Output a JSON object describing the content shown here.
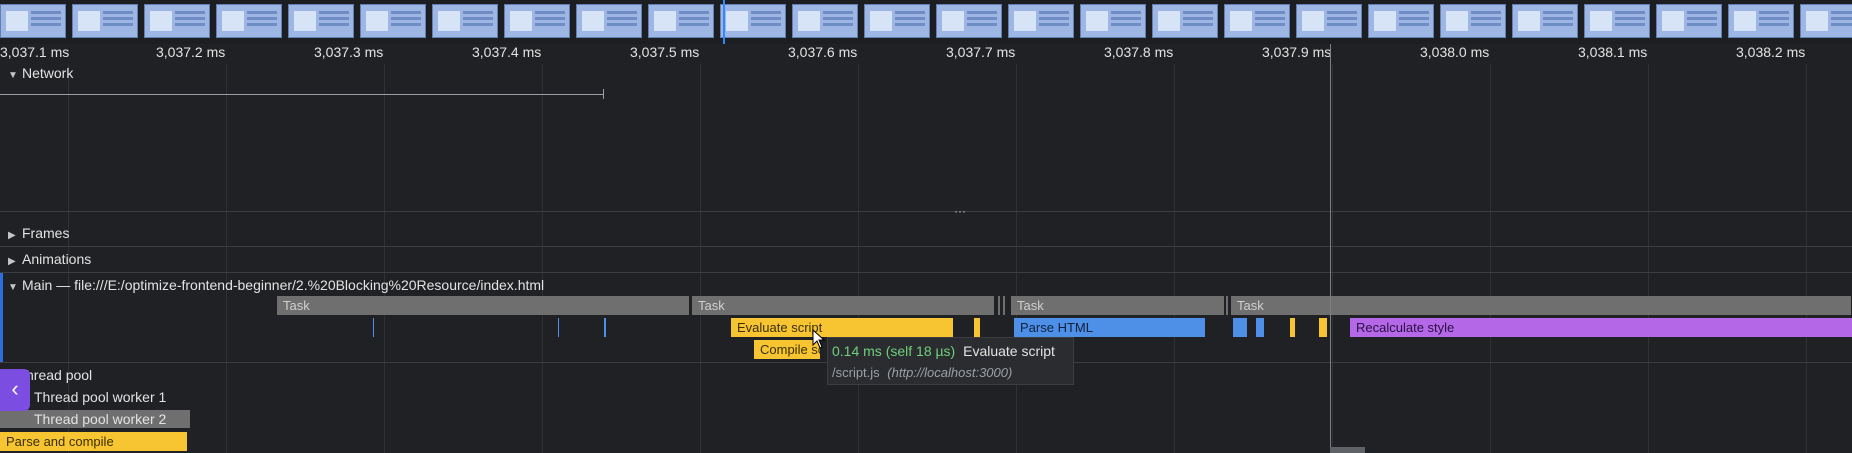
{
  "ruler": {
    "ticks": [
      "3,037.1 ms",
      "3,037.2 ms",
      "3,037.3 ms",
      "3,037.4 ms",
      "3,037.5 ms",
      "3,037.6 ms",
      "3,037.7 ms",
      "3,037.8 ms",
      "3,037.9 ms",
      "3,038.0 ms",
      "3,038.1 ms",
      "3,038.2 ms"
    ]
  },
  "tracks": {
    "network": "Network",
    "frames": "Frames",
    "animations": "Animations",
    "main": "Main — file:///E:/optimize-frontend-beginner/2.%20Blocking%20Resource/index.html",
    "thread_pool": "hread pool",
    "worker1": "Thread pool worker 1",
    "worker2": "Thread pool worker 2"
  },
  "events": {
    "task1": "Task",
    "task2": "Task",
    "task3": "Task",
    "task4": "Task",
    "evaluate_script": "Evaluate script",
    "compile_script": "Compile sc",
    "parse_html": "Parse HTML",
    "recalculate_style": "Recalculate style",
    "parse_and_compile": "Parse and compile"
  },
  "tooltip": {
    "duration": "0.14 ms (self 18 µs)",
    "name": "Evaluate script",
    "file": "/script.js",
    "origin": "(http://localhost:3000)"
  },
  "colors": {
    "scripting": "#f7c531",
    "loading": "#4e8fe8",
    "rendering": "#b468e8",
    "task": "#6f6f6f",
    "accent": "#7b4de0"
  },
  "icons": {
    "expand": "triangle-right-icon",
    "collapse": "triangle-down-icon",
    "side": "chevron-left-icon"
  }
}
